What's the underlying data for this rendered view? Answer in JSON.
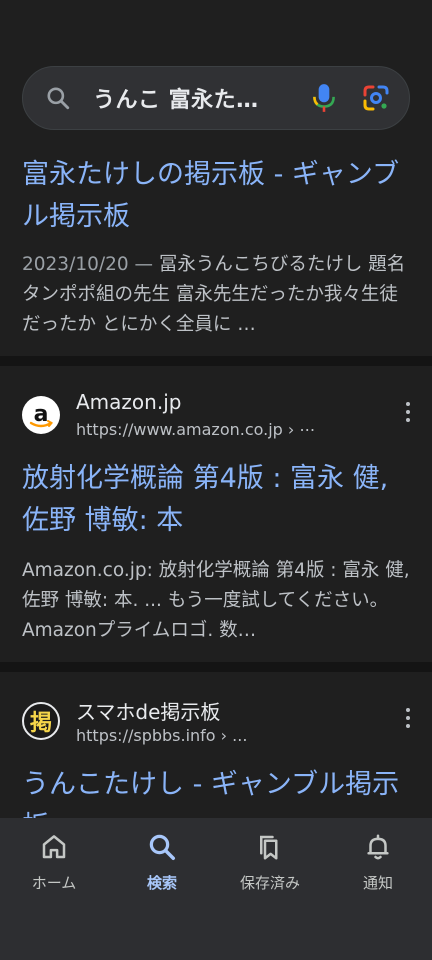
{
  "search": {
    "query": "うんこ 富永た…"
  },
  "results": [
    {
      "title": "富永たけしの掲示板 - ギャンブル掲示板",
      "date": "2023/10/20",
      "snippet": "冨永うんこちびるたけし 題名 タンポポ組の先生 富永先生だったか我々生徒だったか とにかく全員に …"
    },
    {
      "site_name": "Amazon.jp",
      "url": "https://www.amazon.co.jp › ⋯",
      "favicon_letter": "a",
      "title": "放射化学概論 第4版 : 富永 健, 佐野 博敏: 本",
      "snippet": "Amazon.co.jp: 放射化学概論 第4版 : 富永 健, 佐野 博敏: 本. ... もう一度試してください。 Amazonプライムロゴ. 数…"
    },
    {
      "site_name": "スマホde掲示板",
      "url": "https://spbbs.info › ...",
      "favicon_letter": "掲",
      "title": "うんこたけし - ギャンブル掲示板"
    }
  ],
  "bottom_nav": [
    {
      "label": "ホーム",
      "icon": "home-icon"
    },
    {
      "label": "検索",
      "icon": "search-icon",
      "active": true
    },
    {
      "label": "保存済み",
      "icon": "bookmarks-icon"
    },
    {
      "label": "通知",
      "icon": "bell-icon"
    }
  ],
  "colors": {
    "background": "#1f1f1f",
    "link": "#8ab4f8",
    "active_nav": "#a8c7fa"
  }
}
